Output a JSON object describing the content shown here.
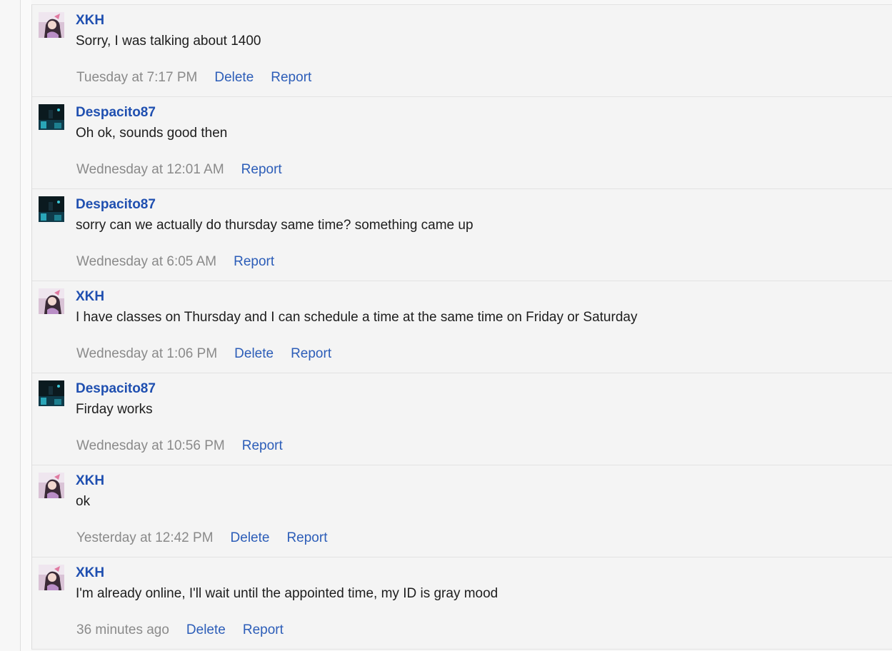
{
  "messages": [
    {
      "author": "XKH",
      "avatar_icon": "anime-girl-avatar-icon",
      "text": "Sorry, I was talking about 1400",
      "time": "Tuesday at 7:17 PM",
      "delete_label": "Delete",
      "report_label": "Report",
      "can_delete": true
    },
    {
      "author": "Despacito87",
      "avatar_icon": "dark-scene-avatar-icon",
      "text": "Oh ok, sounds good then",
      "time": "Wednesday at 12:01 AM",
      "delete_label": "",
      "report_label": "Report",
      "can_delete": false
    },
    {
      "author": "Despacito87",
      "avatar_icon": "dark-scene-avatar-icon",
      "text": "sorry can we actually do thursday same time? something came up",
      "time": "Wednesday at 6:05 AM",
      "delete_label": "",
      "report_label": "Report",
      "can_delete": false
    },
    {
      "author": "XKH",
      "avatar_icon": "anime-girl-avatar-icon",
      "text": "I have classes on Thursday and I can schedule a time at the same time on Friday or Saturday",
      "time": "Wednesday at 1:06 PM",
      "delete_label": "Delete",
      "report_label": "Report",
      "can_delete": true
    },
    {
      "author": "Despacito87",
      "avatar_icon": "dark-scene-avatar-icon",
      "text": "Firday works",
      "time": "Wednesday at 10:56 PM",
      "delete_label": "",
      "report_label": "Report",
      "can_delete": false
    },
    {
      "author": "XKH",
      "avatar_icon": "anime-girl-avatar-icon",
      "text": "ok",
      "time": "Yesterday at 12:42 PM",
      "delete_label": "Delete",
      "report_label": "Report",
      "can_delete": true
    },
    {
      "author": "XKH",
      "avatar_icon": "anime-girl-avatar-icon",
      "text": "I'm already online, I'll wait until the appointed time, my ID is gray mood",
      "time": "36 minutes ago",
      "delete_label": "Delete",
      "report_label": "Report",
      "can_delete": true
    }
  ],
  "colors": {
    "username": "#1f4fb0",
    "link": "#2c5db8",
    "timestamp": "#8a8a8a",
    "text": "#1d1d1d",
    "background": "#f4f4f4"
  }
}
